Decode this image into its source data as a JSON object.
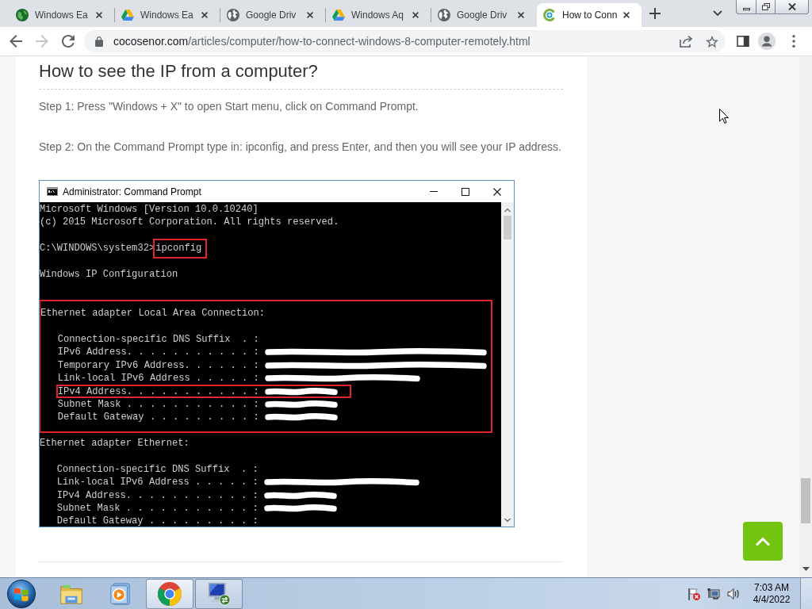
{
  "browser": {
    "tabs": [
      {
        "kind": "earth",
        "title": "Windows Ea",
        "selected": false
      },
      {
        "kind": "drive",
        "title": "Windows Ea",
        "selected": false
      },
      {
        "kind": "globe",
        "title": "Google Driv",
        "selected": false
      },
      {
        "kind": "drive",
        "title": "Windows Aq",
        "selected": false
      },
      {
        "kind": "globe",
        "title": "Google Driv",
        "selected": false
      },
      {
        "kind": "site",
        "title": "How to Conn",
        "selected": true
      }
    ],
    "navigation": [
      {
        "kind": "back",
        "disabled": false
      },
      {
        "kind": "forward",
        "disabled": true
      },
      {
        "kind": "reload",
        "disabled": false
      }
    ],
    "address": {
      "host": "cocosenor.com",
      "path": "/articles/computer/how-to-connect-windows-8-computer-remotely.html"
    }
  },
  "article": {
    "heading": "How to see the IP from a computer?",
    "steps": [
      "Step 1: Press \"Windows + X\" to open Start menu, click on Command Prompt.",
      "Step 2: On the Command Prompt type in: ipconfig, and press Enter, and then you will see your IP address."
    ],
    "command_window": {
      "title": "Administrator: Command Prompt",
      "sections": [
        {
          "highlighted": false,
          "paragraphs": [
            {
              "lines": [
                {
                  "kind": "text",
                  "text": "Microsoft Windows [Version 10.0.10240]",
                  "highlighted": false
                },
                {
                  "kind": "text",
                  "text": "(c) 2015 Microsoft Corporation. All rights reserved.",
                  "highlighted": false
                }
              ]
            },
            {
              "lines": [
                {
                  "kind": "prompt",
                  "text": "C:\\WINDOWS\\system32>",
                  "command": "ipconfig",
                  "highlighted": true
                }
              ]
            },
            {
              "lines": [
                {
                  "kind": "text",
                  "text": "Windows IP Configuration",
                  "highlighted": false
                }
              ]
            }
          ]
        },
        {
          "highlighted": true,
          "paragraphs": [
            {
              "lines": [
                {
                  "kind": "text",
                  "text": "Ethernet adapter Local Area Connection:",
                  "highlighted": false
                }
              ]
            },
            {
              "lines": [
                {
                  "kind": "entry",
                  "text": "Connection-specific DNS Suffix  . :",
                  "highlighted": false
                },
                {
                  "kind": "entry",
                  "text": "IPv6 Address. . . . . . . . . . . :",
                  "redaction": {
                    "kind": "long"
                  },
                  "highlighted": false
                },
                {
                  "kind": "entry",
                  "text": "Temporary IPv6 Address. . . . . . :",
                  "redaction": {
                    "kind": "long"
                  },
                  "highlighted": false
                },
                {
                  "kind": "entry",
                  "text": "Link-local IPv6 Address . . . . . :",
                  "redaction": {
                    "kind": "medium"
                  },
                  "highlighted": false
                },
                {
                  "kind": "entry",
                  "text": "IPv4 Address. . . . . . . . . . . :",
                  "redaction": {
                    "kind": "short"
                  },
                  "highlighted": true
                },
                {
                  "kind": "entry",
                  "text": "Subnet Mask . . . . . . . . . . . :",
                  "redaction": {
                    "kind": "short"
                  },
                  "highlighted": false
                },
                {
                  "kind": "entry",
                  "text": "Default Gateway . . . . . . . . . :",
                  "redaction": {
                    "kind": "short"
                  },
                  "highlighted": false
                }
              ]
            }
          ]
        },
        {
          "highlighted": false,
          "paragraphs": [
            {
              "lines": [
                {
                  "kind": "text",
                  "text": "Ethernet adapter Ethernet:",
                  "highlighted": false
                }
              ]
            },
            {
              "lines": [
                {
                  "kind": "entry",
                  "text": "Connection-specific DNS Suffix  . :",
                  "highlighted": false
                },
                {
                  "kind": "entry",
                  "text": "Link-local IPv6 Address . . . . . :",
                  "redaction": {
                    "kind": "medium"
                  },
                  "highlighted": false
                },
                {
                  "kind": "entry",
                  "text": "IPv4 Address. . . . . . . . . . . :",
                  "redaction": {
                    "kind": "short"
                  },
                  "highlighted": false
                },
                {
                  "kind": "entry",
                  "text": "Subnet Mask . . . . . . . . . . . :",
                  "redaction": {
                    "kind": "short"
                  },
                  "highlighted": false
                },
                {
                  "kind": "entry",
                  "text": "Default Gateway . . . . . . . . . :",
                  "highlighted": false
                }
              ]
            }
          ]
        }
      ]
    }
  },
  "taskbar": {
    "apps": [
      {
        "kind": "folder",
        "running": false,
        "selected": false
      },
      {
        "kind": "player",
        "running": false,
        "selected": false
      },
      {
        "kind": "browser",
        "running": true,
        "selected": true
      },
      {
        "kind": "remote",
        "running": true,
        "selected": false
      }
    ],
    "time": "7:03 AM",
    "date": "4/4/2022"
  }
}
